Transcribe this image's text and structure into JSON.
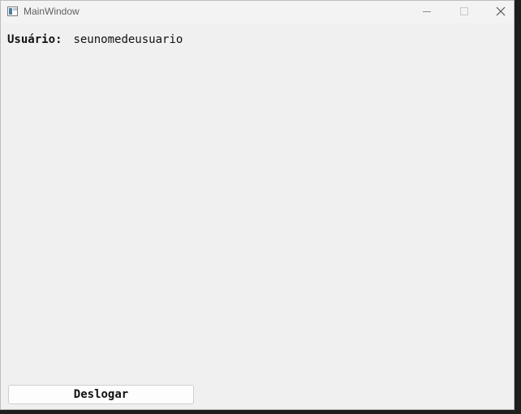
{
  "window": {
    "title": "MainWindow",
    "buttons": {
      "minimize": "minimize-icon",
      "maximize": "maximize-icon",
      "close": "close-icon"
    }
  },
  "content": {
    "user_label": "Usuário:",
    "user_value": "seunomedeusuario",
    "logout_label": "Deslogar"
  },
  "colors": {
    "window_bg": "#f0f0f0",
    "titlebar_bg": "#f3f3f3",
    "text": "#111111",
    "button_bg": "#fdfdfd"
  }
}
